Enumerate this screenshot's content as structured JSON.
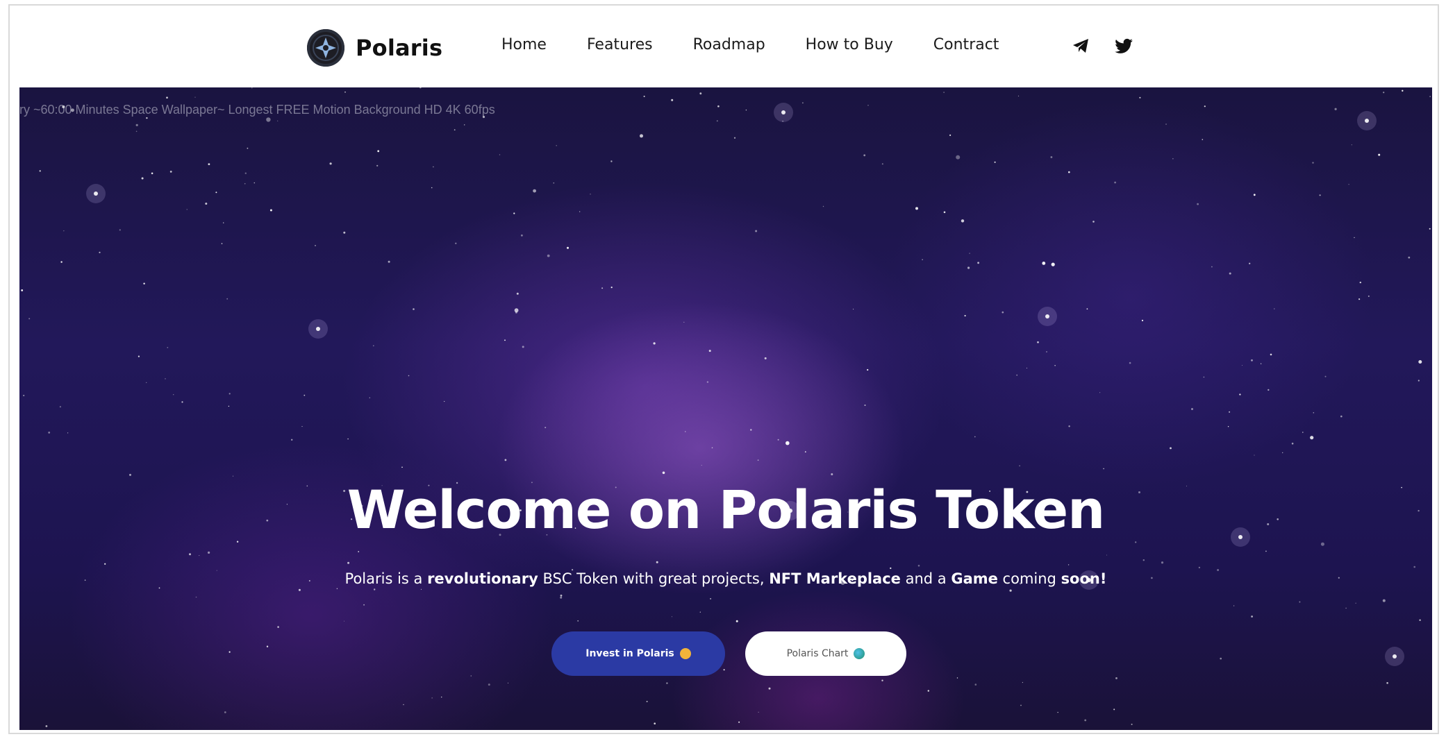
{
  "nav": {
    "brand": "Polaris",
    "items": [
      "Home",
      "Features",
      "Roadmap",
      "How to Buy",
      "Contract"
    ],
    "social": [
      "telegram-icon",
      "twitter-icon"
    ]
  },
  "hero": {
    "video_title": "ry ~60:00 Minutes Space Wallpaper~ Longest FREE Motion Background HD 4K 60fps",
    "headline": "Welcome on Polaris Token",
    "sub": {
      "t1": "Polaris is a ",
      "b1": "revolutionary",
      "t2": " BSC Token with great projects, ",
      "b2": "NFT Markeplace",
      "t3": " and a ",
      "b3": "Game",
      "t4": " coming ",
      "b4": "soon!"
    },
    "buttons": {
      "invest": "Invest in Polaris",
      "chart": "Polaris Chart"
    }
  },
  "colors": {
    "accent": "#2b3aa4",
    "hero_bg": "#1d1450"
  }
}
